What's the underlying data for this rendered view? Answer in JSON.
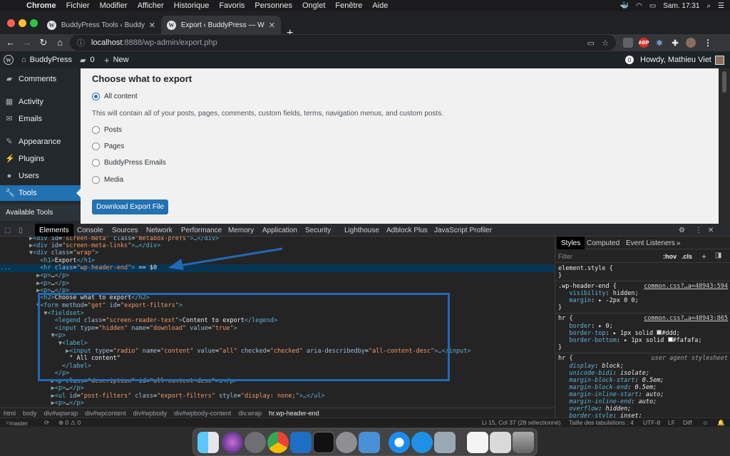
{
  "menubar": {
    "app": "Chrome",
    "items": [
      "Fichier",
      "Modifier",
      "Afficher",
      "Historique",
      "Favoris",
      "Personnes",
      "Onglet",
      "Fenêtre",
      "Aide"
    ],
    "clock": "Sam. 17:31"
  },
  "tabs": [
    {
      "title": "BuddyPress Tools ‹ BuddyPres"
    },
    {
      "title": "Export ‹ BuddyPress — WordP"
    }
  ],
  "address": {
    "host": "localhost",
    "path": ":8888/wp-admin/export.php"
  },
  "extensions": {
    "abp": "ABP"
  },
  "wpbar": {
    "site": "BuddyPress",
    "comments_count": "0",
    "new_label": "New",
    "notif_count": "0",
    "howdy": "Howdy, Mathieu Viet"
  },
  "sidebar": {
    "items": [
      {
        "label": "Comments"
      },
      {
        "label": "Activity"
      },
      {
        "label": "Emails"
      },
      {
        "label": "Appearance"
      },
      {
        "label": "Plugins"
      },
      {
        "label": "Users"
      },
      {
        "label": "Tools"
      }
    ],
    "submenu": "Available Tools"
  },
  "export": {
    "heading": "Choose what to export",
    "all_content": "All content",
    "description": "This will contain all of your posts, pages, comments, custom fields, terms, navigation menus, and custom posts.",
    "options": [
      "Posts",
      "Pages",
      "BuddyPress Emails",
      "Media"
    ],
    "button": "Download Export File"
  },
  "devtools": {
    "tabs": [
      "Elements",
      "Console",
      "Sources",
      "Network",
      "Performance",
      "Memory",
      "Application",
      "Security",
      "Lighthouse",
      "Adblock Plus",
      "JavaScript Profiler"
    ],
    "styles_tabs": [
      "Styles",
      "Computed",
      "Event Listeners"
    ],
    "filter_placeholder": "Filter",
    "filter_hov": ":hov",
    "filter_cls": ".cls",
    "breadcrumbs": [
      "html",
      "body",
      "div#wpwrap",
      "div#wpcontent",
      "div#wpbody",
      "div#wpbody-content",
      "div.wrap",
      "hr.wp-header-end"
    ]
  },
  "statusbar": {
    "branch": "master",
    "problems": "⊗ 0 ⚠ 0",
    "cursor": "Li 15, Col 37 (28 sélectionné)",
    "tabsize": "Taille des tabulations : 4",
    "encoding": "UTF-8",
    "eol": "LF",
    "mode": "Diff"
  },
  "colors": {
    "wp_blue": "#2271b1",
    "highlight_box": "#2169b5",
    "selected_row": "#073655"
  }
}
